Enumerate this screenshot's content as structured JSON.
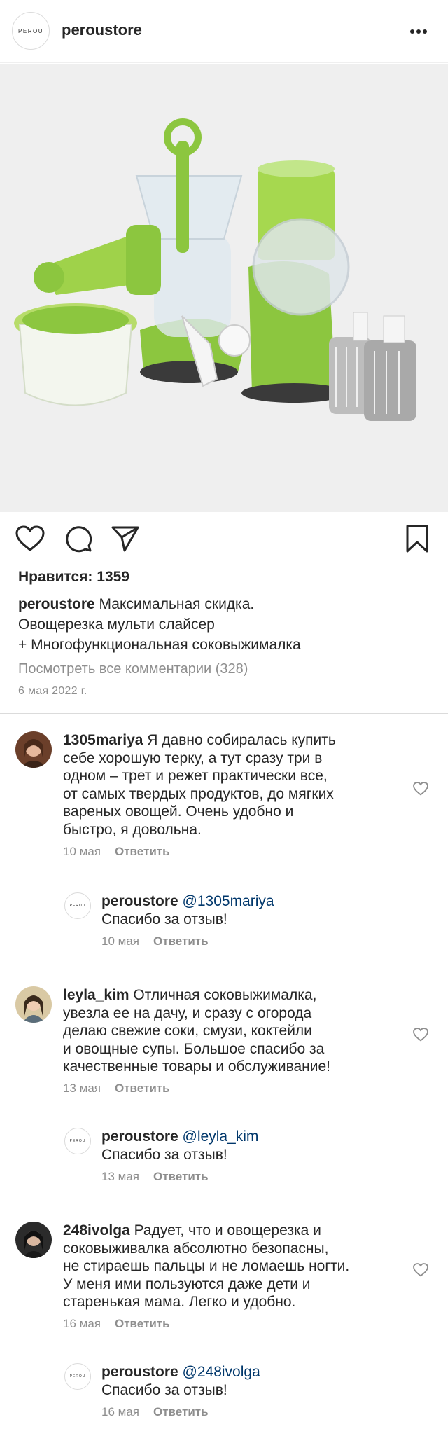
{
  "header": {
    "logo_text": "PEROU",
    "username": "peroustore"
  },
  "post": {
    "likes": "Нравится: 1359",
    "caption_user": "peroustore",
    "caption_line1": "Максимальная скидка.",
    "caption_line2": "Овощерезка мульти слайсер",
    "caption_line3": "+ Многофункциональная соковыжималка",
    "view_all": "Посмотреть все комментарии (328)",
    "date": "6 мая 2022 г."
  },
  "reply_label": "Ответить",
  "comments": [
    {
      "user": "1305mariya",
      "lines": [
        "Я давно собиралась купить",
        "себе хорошую терку, а тут сразу три в",
        "одном – трет и режет практически все,",
        "от самых твердых продуктов, до мягких",
        "вареных овощей. Очень удобно и",
        "быстро, я довольна."
      ],
      "date": "10 мая"
    },
    {
      "user": "peroustore",
      "mention": "@1305mariya",
      "text": "Спасибо за отзыв!",
      "date": "10 мая"
    },
    {
      "user": "leyla_kim",
      "lines": [
        "Отличная соковыжималка,",
        "увезла ее на дачу, и сразу с огорода",
        "делаю свежие соки, смузи, коктейли",
        "и овощные супы. Большое спасибо за",
        "качественные товары и обслуживание!"
      ],
      "date": "13 мая"
    },
    {
      "user": "peroustore",
      "mention": "@leyla_kim",
      "text": "Спасибо за отзыв!",
      "date": "13 мая"
    },
    {
      "user": "248ivolga",
      "lines": [
        "Радует, что и овощерезка и",
        "соковыживалка абсолютно безопасны,",
        "не стираешь пальцы и не ломаешь ногти.",
        "У меня ими пользуются даже дети и",
        "старенькая мама. Легко и удобно."
      ],
      "date": "16 мая"
    },
    {
      "user": "peroustore",
      "mention": "@248ivolga",
      "text": "Спасибо за отзыв!",
      "date": "16 мая"
    }
  ],
  "colors": {
    "accent_green": "#8cc63f",
    "mention_blue": "#00376b",
    "muted": "#8e8e8e"
  },
  "icons": [
    "more-horizontal-icon",
    "heart-icon",
    "comment-icon",
    "send-icon",
    "bookmark-icon"
  ]
}
